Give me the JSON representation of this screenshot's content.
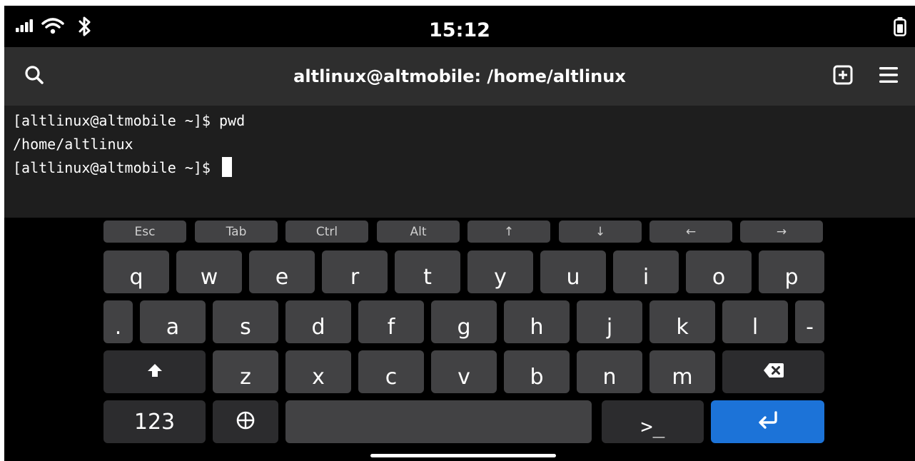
{
  "status_bar": {
    "time": "15:12",
    "icons": [
      "signal-icon",
      "wifi-icon",
      "bluetooth-icon",
      "battery-icon"
    ]
  },
  "header": {
    "title": "altlinux@altmobile: /home/altlinux",
    "icons": [
      "search-icon",
      "new-tab-icon",
      "menu-icon"
    ]
  },
  "terminal": {
    "lines": [
      "[altlinux@altmobile ~]$ pwd",
      "/home/altlinux",
      "[altlinux@altmobile ~]$ "
    ]
  },
  "keyboard": {
    "special_row": [
      "Esc",
      "Tab",
      "Ctrl",
      "Alt",
      "↑",
      "↓",
      "←",
      "→"
    ],
    "row1": [
      "q",
      "w",
      "e",
      "r",
      "t",
      "y",
      "u",
      "i",
      "o",
      "p"
    ],
    "row2": [
      ".",
      "a",
      "s",
      "d",
      "f",
      "g",
      "h",
      "j",
      "k",
      "l",
      "-"
    ],
    "row3": [
      "z",
      "x",
      "c",
      "v",
      "b",
      "n",
      "m"
    ],
    "bottom": {
      "numbers_label": "123",
      "terminal_key_label": ">_"
    },
    "icons": [
      "shift-icon",
      "backspace-icon",
      "globe-icon",
      "enter-icon"
    ],
    "colors": {
      "key": "#424244",
      "dark_key": "#2c2c2e",
      "enter": "#1c73d8"
    }
  }
}
